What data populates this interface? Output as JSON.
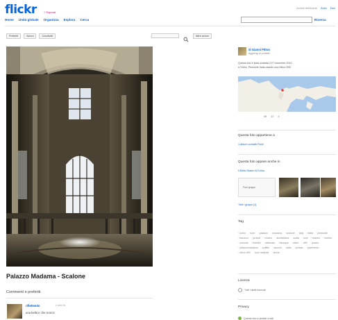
{
  "header": {
    "logo_main": "flickr",
    "logo_suffix": "",
    "beta": "+ Esporat",
    "nav": [
      "Home",
      "Unità globale",
      "Organizza",
      "Esplora",
      "Cerca"
    ],
    "top_links": [
      "Accedi dell'autore",
      "Aiuto",
      "Esci"
    ],
    "search_button": "Ricerca"
  },
  "toolbar": {
    "buttons": [
      "Preferiti",
      "Azioni",
      "Condividi"
    ],
    "right_button": "Altre azioni"
  },
  "photo": {
    "title": "Palazzo Madama - Scalone"
  },
  "comments": {
    "title": "Commenti e preferiti",
    "author": "riflettendo",
    "date": "2 anni fa",
    "text": "una bella e che scorci!"
  },
  "sidebar": {
    "owner_name": "di Gianni Pitton",
    "owner_sub": "Aggiungi ai contatti",
    "taken_lines": [
      "Questa foto è stata scattata il 27 novembre 2010",
      "a Torino, Piemonte Italia usando una Nikon D90."
    ],
    "map_stats": [
      "38",
      "12",
      "4"
    ],
    "albums_title": "Questa foto appartiene a",
    "albums_link": "1 album contatti Flickr",
    "groups_title": "Questa foto appare anche in",
    "groups_link": "Il Bello Musei di Torino",
    "groups_box_label": "Pool gruppo",
    "groups_footer": "Tutti i gruppi (1)",
    "tags_title": "Tag",
    "tags": [
      "torino",
      "turin",
      "palazzo",
      "madama",
      "scalone",
      "italy",
      "italia",
      "piemonte",
      "barocco",
      "juvarra",
      "museo",
      "architettura",
      "scala",
      "luce",
      "marmo",
      "interno",
      "colonne",
      "finestre",
      "staircase",
      "baroque",
      "nikon",
      "d90",
      "juvara",
      "palazzomadama",
      "soffitto",
      "stucchi",
      "volta",
      "portale",
      "pavimento",
      "nikon d90",
      "luce naturale",
      "storia"
    ],
    "license_title": "Licenza",
    "license_text": "Tutti i diritti riservati",
    "privacy_title": "Privacy",
    "privacy_text": "Questa foto è visibile a tutti"
  },
  "icon_names": [
    "search-icon",
    "map-icon",
    "license-icon"
  ]
}
